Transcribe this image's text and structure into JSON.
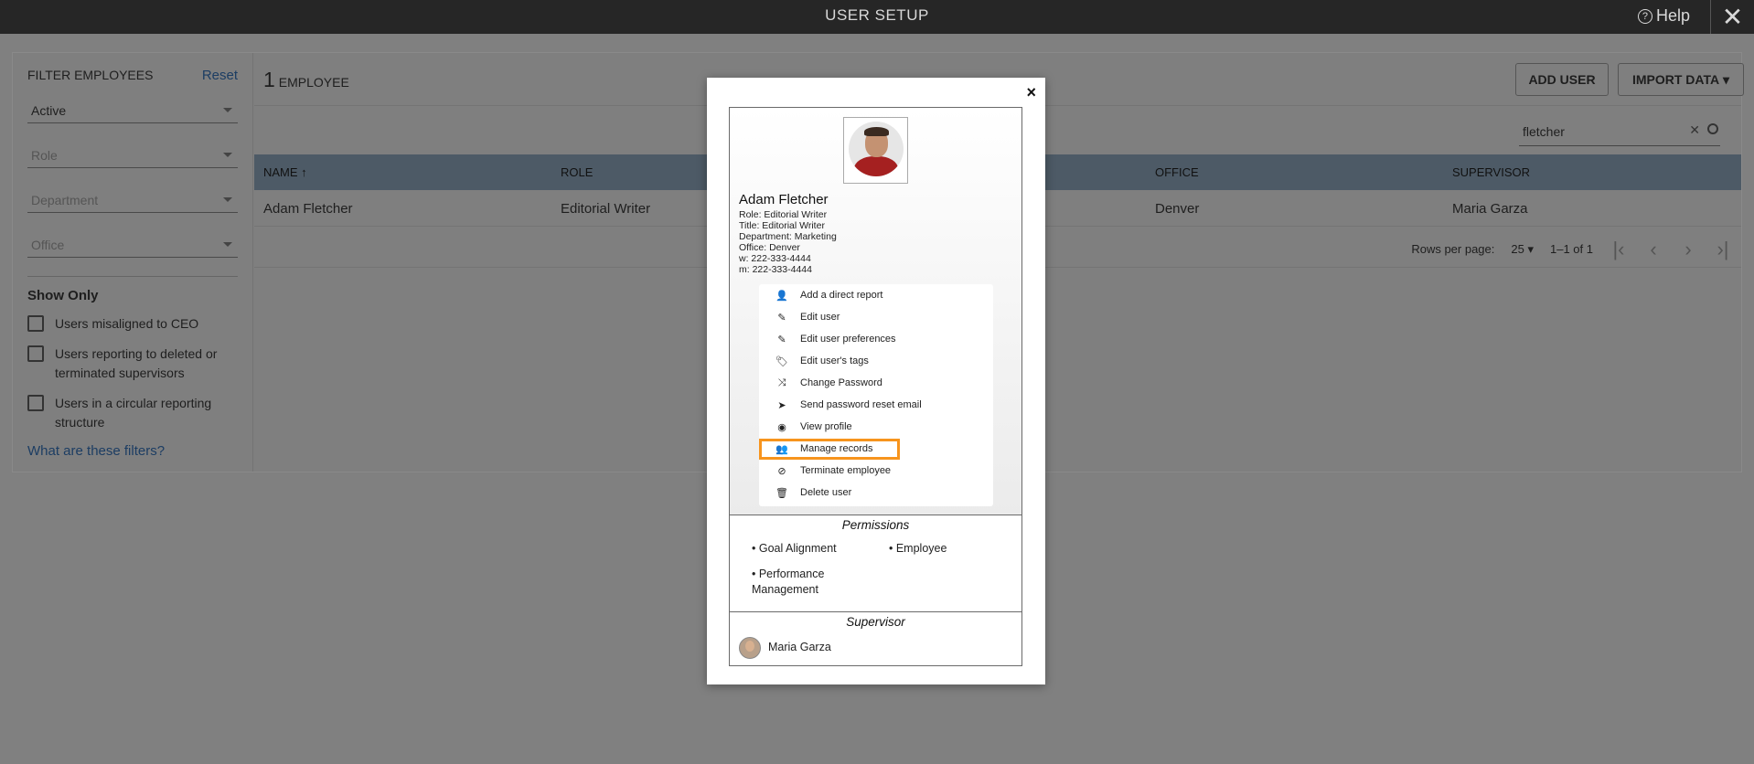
{
  "topbar": {
    "title": "USER SETUP",
    "help_label": "Help",
    "close_glyph": "✕"
  },
  "filters": {
    "heading": "FILTER EMPLOYEES",
    "reset_label": "Reset",
    "status_value": "Active",
    "role_placeholder": "Role",
    "department_placeholder": "Department",
    "office_placeholder": "Office",
    "show_only_label": "Show Only",
    "checkboxes": [
      "Users misaligned to CEO",
      "Users reporting to deleted or terminated supervisors",
      "Users in a circular reporting structure"
    ],
    "help_link": "What are these filters?"
  },
  "main": {
    "count": "1",
    "count_label": "EMPLOYEE",
    "add_user_label": "ADD USER",
    "import_label": "IMPORT DATA",
    "search_value": "fletcher",
    "columns": [
      "NAME",
      "ROLE",
      "",
      "OFFICE",
      "SUPERVISOR"
    ],
    "row": [
      "Adam Fletcher",
      "Editorial Writer",
      "",
      "Denver",
      "Maria Garza"
    ],
    "rows_per_page_label": "Rows per page:",
    "rows_per_page_value": "25",
    "range_label": "1–1 of 1"
  },
  "modal": {
    "close_glyph": "×",
    "name": "Adam Fletcher",
    "info": [
      "Role: Editorial Writer",
      "Title: Editorial Writer",
      "Department: Marketing",
      "Office: Denver",
      "w: 222-333-4444",
      "m: 222-333-4444"
    ],
    "menu": [
      {
        "label": "Add a direct report",
        "icon": "user-icon"
      },
      {
        "label": "Edit user",
        "icon": "edit-icon"
      },
      {
        "label": "Edit user preferences",
        "icon": "edit-icon"
      },
      {
        "label": "Edit user's tags",
        "icon": "tags-icon"
      },
      {
        "label": "Change Password",
        "icon": "shuffle-icon"
      },
      {
        "label": "Send password reset email",
        "icon": "send-icon"
      },
      {
        "label": "View profile",
        "icon": "eye-icon"
      },
      {
        "label": "Manage records",
        "icon": "user-records-icon"
      },
      {
        "label": "Terminate employee",
        "icon": "ban-icon"
      },
      {
        "label": "Delete user",
        "icon": "trash-icon"
      }
    ],
    "highlight_color": "#f7941d",
    "permissions_heading": "Permissions",
    "permissions": [
      "• Goal Alignment",
      "• Employee",
      "• Performance Management"
    ],
    "supervisor_heading": "Supervisor",
    "supervisor_name": "Maria Garza"
  }
}
